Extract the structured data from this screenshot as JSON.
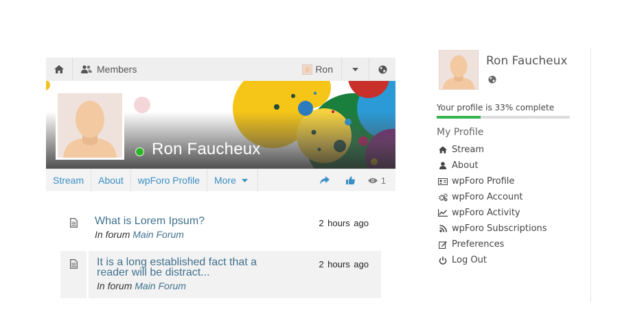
{
  "topbar": {
    "home_icon": "home-icon",
    "members_label": "Members",
    "user_label": "Ron",
    "dropdown_icon": "caret-down-icon",
    "globe_icon": "globe-icon"
  },
  "profile": {
    "display_name": "Ron Faucheux",
    "online_color": "#2db528"
  },
  "tabs": {
    "stream": "Stream",
    "about": "About",
    "wpforo_profile": "wpForo Profile",
    "more": "More",
    "views_count": "1"
  },
  "activity": [
    {
      "title": "What is Lorem Ipsum?",
      "forum_prefix": "In forum",
      "forum_name": "Main Forum",
      "time": "2 hours ago"
    },
    {
      "title_line1": "It is a long established fact that a",
      "title_line2": "reader will be distract...",
      "forum_prefix": "In forum",
      "forum_name": "Main Forum",
      "time": "2 hours ago"
    }
  ],
  "sidebar": {
    "name": "Ron Faucheux",
    "progress_text": "Your profile is 33% complete",
    "progress_fraction": 0.33,
    "progress_color": "#37b24d",
    "menu_heading": "My Profile",
    "menu": [
      {
        "label": "Stream",
        "icon": "home-icon"
      },
      {
        "label": "About",
        "icon": "user-icon"
      },
      {
        "label": "wpForo Profile",
        "icon": "id-card-icon"
      },
      {
        "label": "wpForo Account",
        "icon": "cogs-icon"
      },
      {
        "label": "wpForo Activity",
        "icon": "line-chart-icon"
      },
      {
        "label": "wpForo Subscriptions",
        "icon": "rss-icon"
      },
      {
        "label": "Preferences",
        "icon": "edit-icon"
      },
      {
        "label": "Log Out",
        "icon": "power-icon"
      }
    ]
  },
  "colors": {
    "link": "#3a8fc4",
    "activity_link": "#40718f"
  }
}
